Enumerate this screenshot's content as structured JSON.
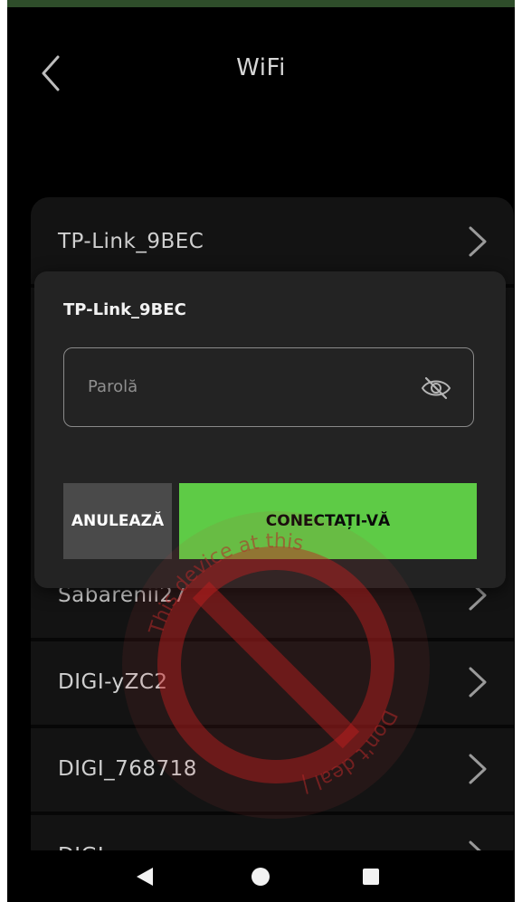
{
  "header": {
    "title": "WiFi",
    "back_icon": "chevron-left-icon"
  },
  "networks": [
    {
      "name": "TP-Link_9BEC"
    },
    {
      "name": "Sabarenii27"
    },
    {
      "name": "DIGI-yZC2"
    },
    {
      "name": "DIGI_768718"
    },
    {
      "name": "DIGI-..."
    }
  ],
  "dialog": {
    "network_name": "TP-Link_9BEC",
    "password_placeholder": "Parolă",
    "password_value": "",
    "visibility_icon": "eye-off-icon",
    "cancel_label": "ANULEAZĂ",
    "connect_label": "CONECTAȚI-VĂ"
  },
  "watermark": {
    "line1": "This device at this",
    "line2": "Don't deal |",
    "line3": "This device",
    "line4": "Don't deal"
  },
  "navbar": {
    "back_icon": "nav-back-triangle-icon",
    "home_icon": "nav-home-circle-icon",
    "recents_icon": "nav-recents-square-icon"
  },
  "colors": {
    "accent": "#5ecb46",
    "background": "#000000",
    "card": "#131313",
    "dialog": "#232323",
    "cancel_bg": "#4a4a4a",
    "watermark": "#c41e1e"
  }
}
